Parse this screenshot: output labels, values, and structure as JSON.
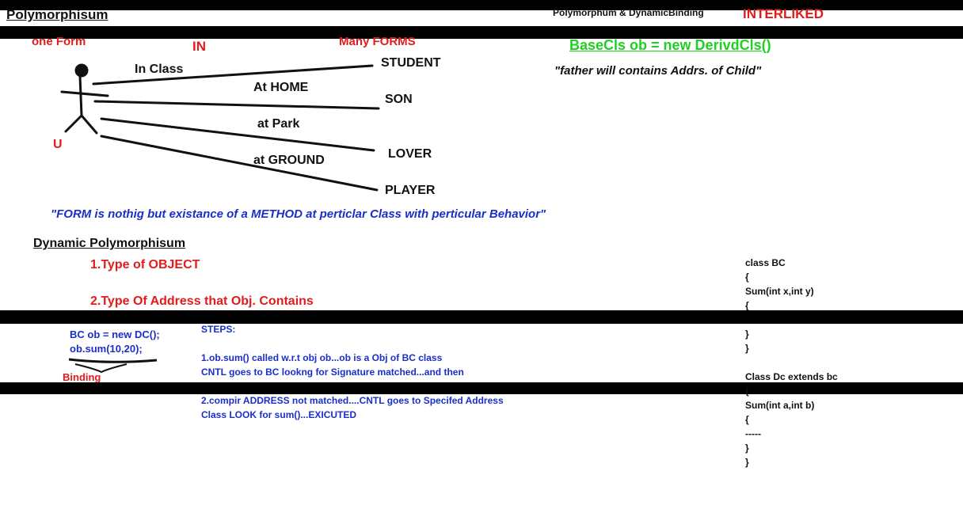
{
  "header": {
    "title": "Polymorphisum",
    "center_title": "Polymorphum & DynamicBinding",
    "interlinked": "INTERLIKED"
  },
  "diagram": {
    "one_form": "one Form",
    "in_label": "IN",
    "many_forms": "Many FORMS",
    "u_label": "U",
    "contexts": [
      {
        "label": "In Class",
        "target": "STUDENT"
      },
      {
        "label": "At HOME",
        "target": "SON"
      },
      {
        "label": "at Park",
        "target": "LOVER"
      },
      {
        "label": "at GROUND",
        "target": "PLAYER"
      }
    ],
    "definition": "\"FORM is nothig but existance of a METHOD at perticlar Class  with perticular Behavior\""
  },
  "right_top": {
    "code": "BaseCls ob = new DerivdCls()",
    "quote": "\"father will contains Addrs. of Child\""
  },
  "dynamic": {
    "heading": "Dynamic Polymorphisum",
    "point1": "1.Type of OBJECT",
    "point2": "2.Type Of Address that Obj. Contains"
  },
  "example": {
    "line1": "BC ob = new DC();",
    "line2": "ob.sum(10,20);",
    "binding": "Binding"
  },
  "steps": {
    "title": "STEPS:",
    "s1a": "1.ob.sum() called w.r.t obj ob...ob is a Obj of BC class",
    "s1b": "CNTL goes to BC lookng for Signature matched...and then",
    "s2a": "2.compir ADDRESS not matched....CNTL goes to Specifed Address",
    "s2b": "Class LOOK for sum()...EXICUTED"
  },
  "code_right": {
    "lines": [
      "class BC",
      "{",
      "Sum(int x,int y)",
      "{",
      "}",
      "}",
      "Class Dc extends bc",
      "{",
      "Sum(int a,int b)",
      "{",
      "-----",
      "}",
      "}"
    ]
  },
  "colors": {
    "red": "#e21b1b",
    "blue": "#1a2fc9",
    "green": "#1fd11f",
    "black": "#111111"
  }
}
